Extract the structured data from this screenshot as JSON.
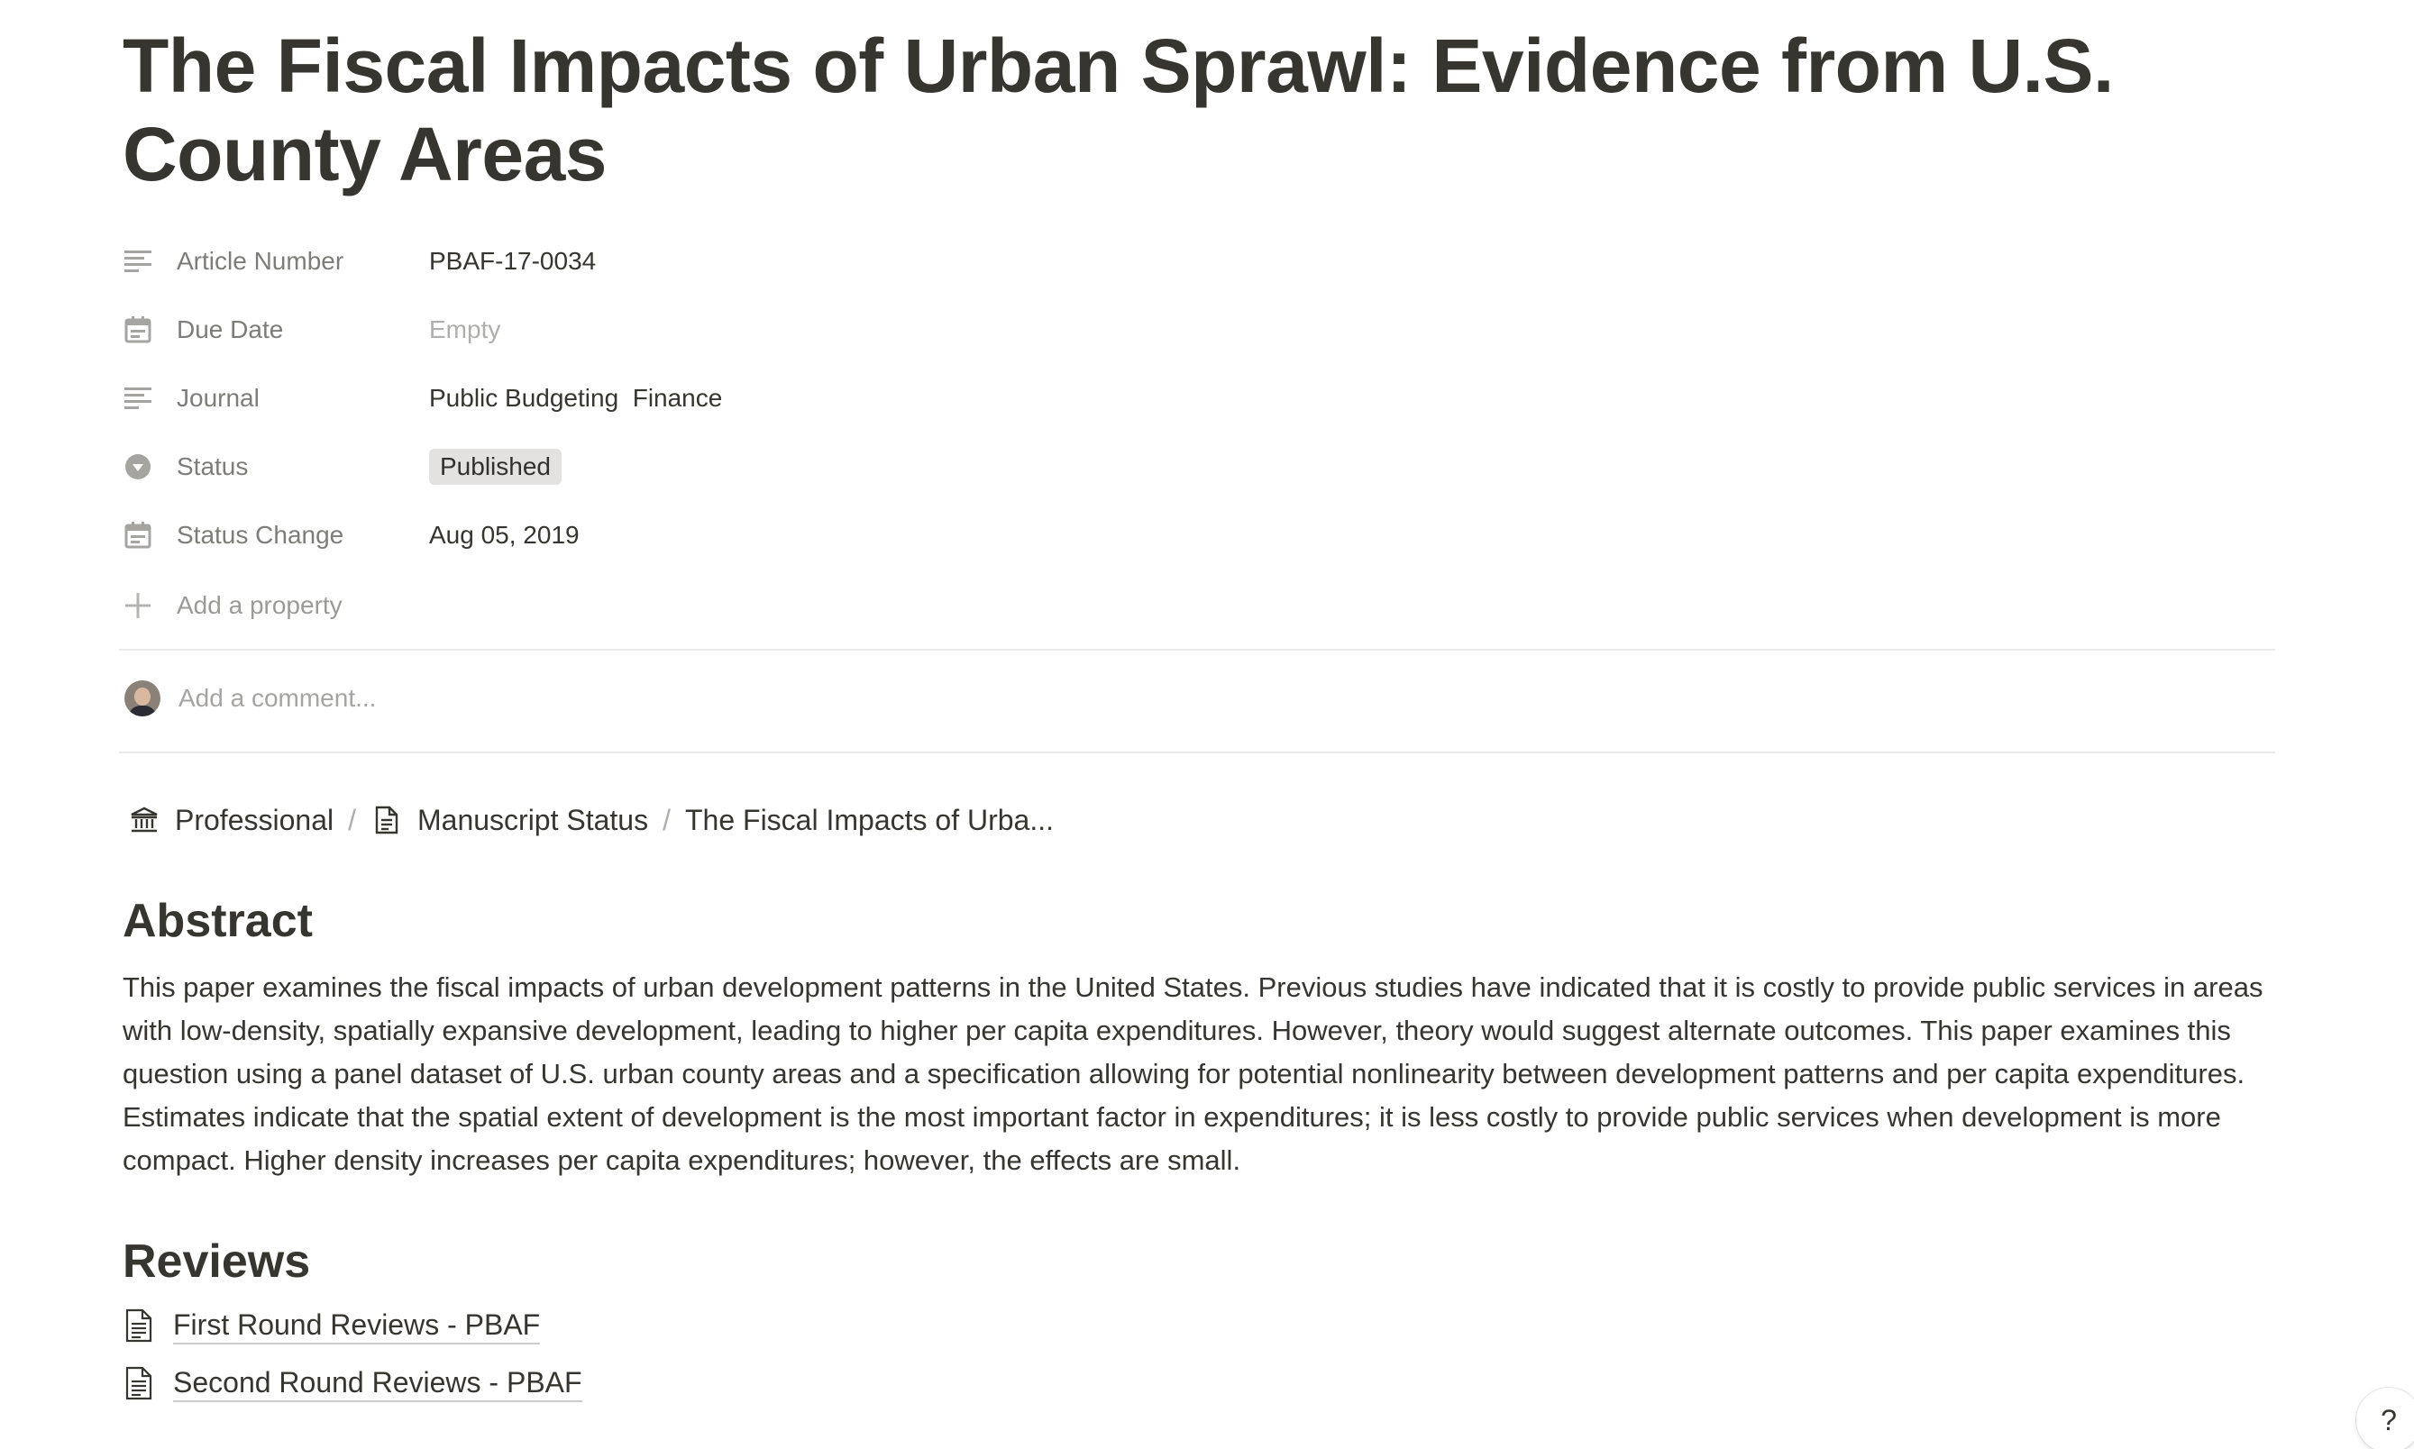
{
  "page": {
    "title": "The Fiscal Impacts of Urban Sprawl: Evidence from U.S. County Areas"
  },
  "properties": [
    {
      "icon": "text-lines-icon",
      "name": "Article Number",
      "value": "PBAF-17-0034"
    },
    {
      "icon": "calendar-icon",
      "name": "Due Date",
      "value": "Empty"
    },
    {
      "icon": "text-lines-icon",
      "name": "Journal",
      "value": "Public Budgeting  Finance"
    },
    {
      "icon": "select-circle-icon",
      "name": "Status",
      "value": "Published"
    },
    {
      "icon": "calendar-icon",
      "name": "Status Change",
      "value": "Aug 05, 2019"
    }
  ],
  "add_property_label": "Add a property",
  "comment": {
    "placeholder": "Add a comment..."
  },
  "breadcrumb": [
    {
      "icon": "bank-building-icon",
      "label": "Professional"
    },
    {
      "icon": "document-icon",
      "label": "Manuscript Status"
    },
    {
      "label": "The Fiscal Impacts of Urba..."
    }
  ],
  "abstract": {
    "heading": "Abstract",
    "text": "This paper examines the fiscal impacts of urban development patterns in the United States. Previous studies have indicated that it is costly to provide public services in areas with low-density, spatially expansive development, leading to higher per capita expenditures. However, theory would suggest alternate outcomes. This paper examines this question using a panel dataset of U.S. urban county areas and a specification allowing for potential nonlinearity between development patterns and per capita expenditures. Estimates indicate that the spatial extent of development is the most important factor in expenditures; it is less costly to provide public services when development is more compact. Higher density increases per capita expenditures; however, the effects are small."
  },
  "reviews": {
    "heading": "Reviews",
    "links": [
      {
        "icon": "document-icon",
        "label": "First Round Reviews - PBAF"
      },
      {
        "icon": "document-icon",
        "label": "Second Round Reviews - PBAF"
      }
    ]
  },
  "help_button": {
    "label": "?"
  },
  "colors": {
    "text": "#37352f",
    "muted": "#9b9a97",
    "tag_bg": "#e3e2e0",
    "divider": "#ebeae8"
  }
}
